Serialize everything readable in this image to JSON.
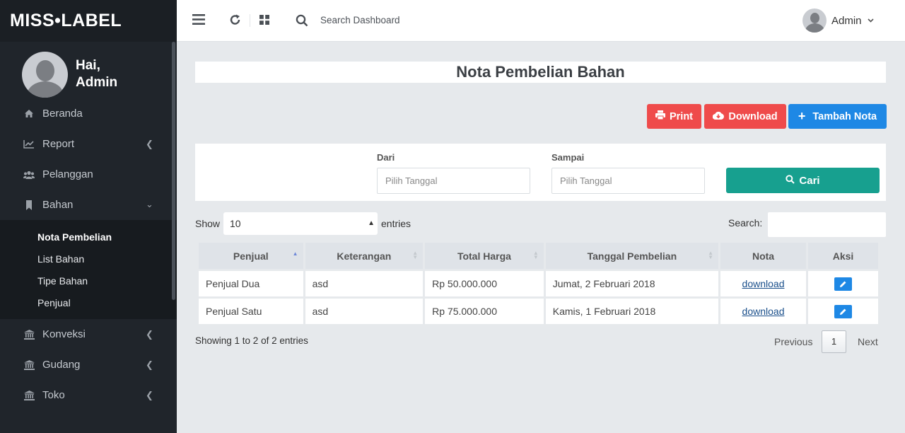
{
  "brand": {
    "logo_text": "MISS•LABEL"
  },
  "profile": {
    "greeting": "Hai,",
    "name": "Admin"
  },
  "sidebar": {
    "items": [
      {
        "label": "Beranda",
        "icon": "home-icon"
      },
      {
        "label": "Report",
        "icon": "chart-line-icon",
        "has_chevron": true
      },
      {
        "label": "Pelanggan",
        "icon": "users-icon"
      },
      {
        "label": "Bahan",
        "icon": "bookmark-icon",
        "expanded": true
      },
      {
        "label": "Konveksi",
        "icon": "institution-icon",
        "has_chevron": true
      },
      {
        "label": "Gudang",
        "icon": "institution-icon",
        "has_chevron": true
      },
      {
        "label": "Toko",
        "icon": "institution-icon",
        "has_chevron": true
      }
    ],
    "submenu": [
      {
        "label": "Nota Pembelian",
        "active": true
      },
      {
        "label": "List Bahan"
      },
      {
        "label": "Tipe Bahan"
      },
      {
        "label": "Penjual"
      }
    ]
  },
  "topbar": {
    "search_placeholder": "Search Dashboard",
    "user_name": "Admin"
  },
  "page": {
    "title": "Nota Pembelian Bahan",
    "buttons": {
      "print": "Print",
      "download": "Download",
      "add": "Tambah Nota"
    }
  },
  "filter": {
    "from_label": "Dari",
    "from_placeholder": "Pilih Tanggal",
    "to_label": "Sampai",
    "to_placeholder": "Pilih Tanggal",
    "search_button": "Cari"
  },
  "table_controls": {
    "show_label": "Show",
    "entries_value": "10",
    "entries_label": "entries",
    "search_label": "Search:"
  },
  "table": {
    "columns": [
      "Penjual",
      "Keterangan",
      "Total Harga",
      "Tanggal Pembelian",
      "Nota",
      "Aksi"
    ],
    "rows": [
      {
        "penjual": "Penjual Dua",
        "keterangan": "asd",
        "total": "Rp 50.000.000",
        "tanggal": "Jumat, 2 Februari 2018",
        "nota": "download"
      },
      {
        "penjual": "Penjual Satu",
        "keterangan": "asd",
        "total": "Rp 75.000.000",
        "tanggal": "Kamis, 1 Februari 2018",
        "nota": "download"
      }
    ]
  },
  "footer": {
    "info": "Showing 1 to 2 of 2 entries",
    "previous": "Previous",
    "page": "1",
    "next": "Next"
  },
  "colors": {
    "sidebar_bg": "#20252b",
    "danger": "#ef4b4b",
    "primary": "#1e88e5",
    "teal": "#17a08f",
    "page_bg": "#e6e9ec"
  }
}
